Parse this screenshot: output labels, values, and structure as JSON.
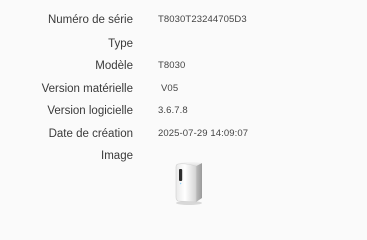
{
  "device_info": {
    "rows": [
      {
        "label": "Numéro de série",
        "value": "T8030T23244705D3"
      },
      {
        "label": "Type",
        "value": ""
      },
      {
        "label": "Modèle",
        "value": "T8030"
      },
      {
        "label": "Version matérielle",
        "value": "V05"
      },
      {
        "label": "Version logicielle",
        "value": "3.6.7.8"
      },
      {
        "label": "Date de création",
        "value": "2025-07-29 14:09:07"
      },
      {
        "label": "Image",
        "value": ""
      }
    ],
    "image_icon": "homebase-device-icon"
  }
}
